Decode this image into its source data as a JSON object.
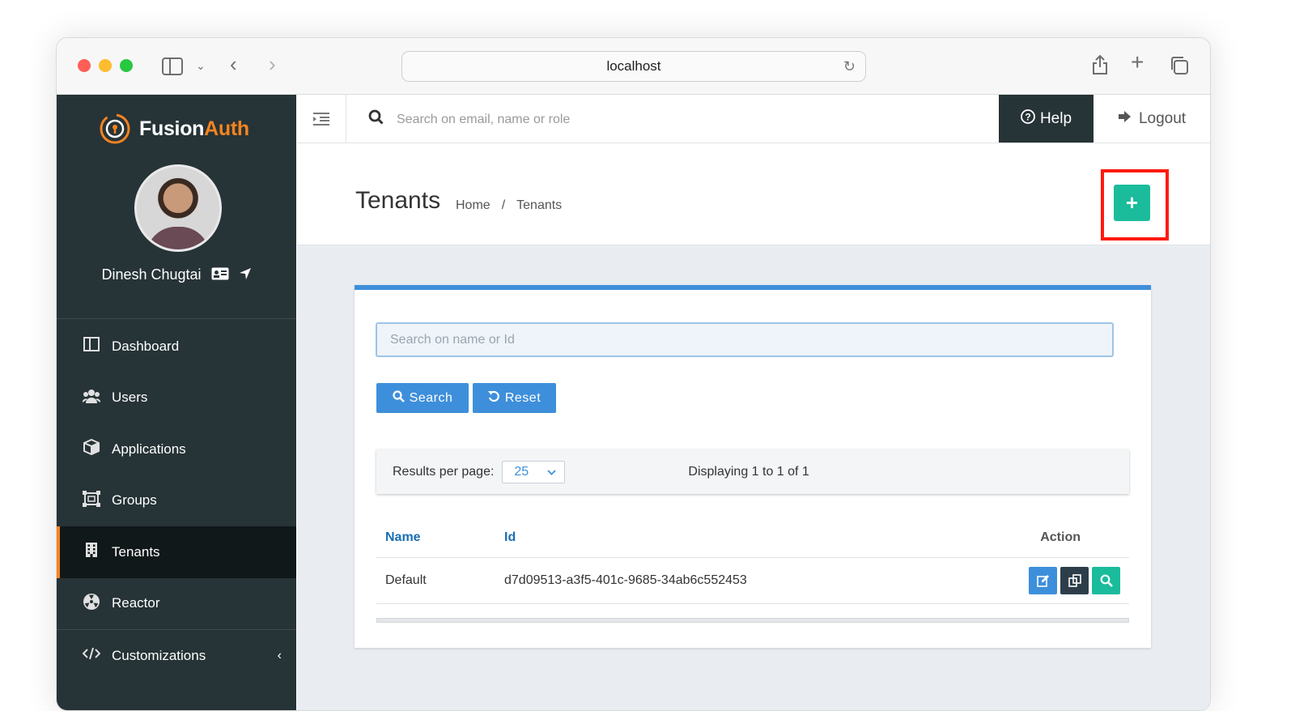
{
  "browser": {
    "url": "localhost",
    "icons": [
      "sidebar-icon",
      "chevron-down-icon",
      "back-icon",
      "forward-icon",
      "reload-icon",
      "share-icon",
      "new-tab-icon",
      "tabs-icon"
    ]
  },
  "sidebar": {
    "brand_part1": "Fusion",
    "brand_part2": "Auth",
    "user_name": "Dinesh Chugtai",
    "items": [
      {
        "label": "Dashboard",
        "icon": "dashboard-icon"
      },
      {
        "label": "Users",
        "icon": "users-icon"
      },
      {
        "label": "Applications",
        "icon": "cube-icon"
      },
      {
        "label": "Groups",
        "icon": "groups-icon"
      },
      {
        "label": "Tenants",
        "icon": "building-icon",
        "active": true
      },
      {
        "label": "Reactor",
        "icon": "reactor-icon"
      },
      {
        "label": "Customizations",
        "icon": "code-icon"
      }
    ]
  },
  "topbar": {
    "search_placeholder": "Search on email, name or role",
    "help_label": "Help",
    "logout_label": "Logout"
  },
  "page": {
    "title": "Tenants",
    "breadcrumb": [
      "Home",
      "/",
      "Tenants"
    ],
    "add_label": "+"
  },
  "panel": {
    "search_placeholder": "Search on name or Id",
    "search_button": "Search",
    "reset_button": "Reset",
    "results_per_page_label": "Results per page:",
    "results_per_page_value": "25",
    "displaying": "Displaying 1 to 1 of 1",
    "columns": [
      "Name",
      "Id",
      "Action"
    ],
    "rows": [
      {
        "name": "Default",
        "id": "d7d09513-a3f5-401c-9685-34ab6c552453"
      }
    ]
  },
  "colors": {
    "sidebar_bg": "#263337",
    "accent_orange": "#f58320",
    "primary_blue": "#3e8fdb",
    "add_green": "#1abc9c",
    "highlight_red": "#ff1a0e"
  }
}
